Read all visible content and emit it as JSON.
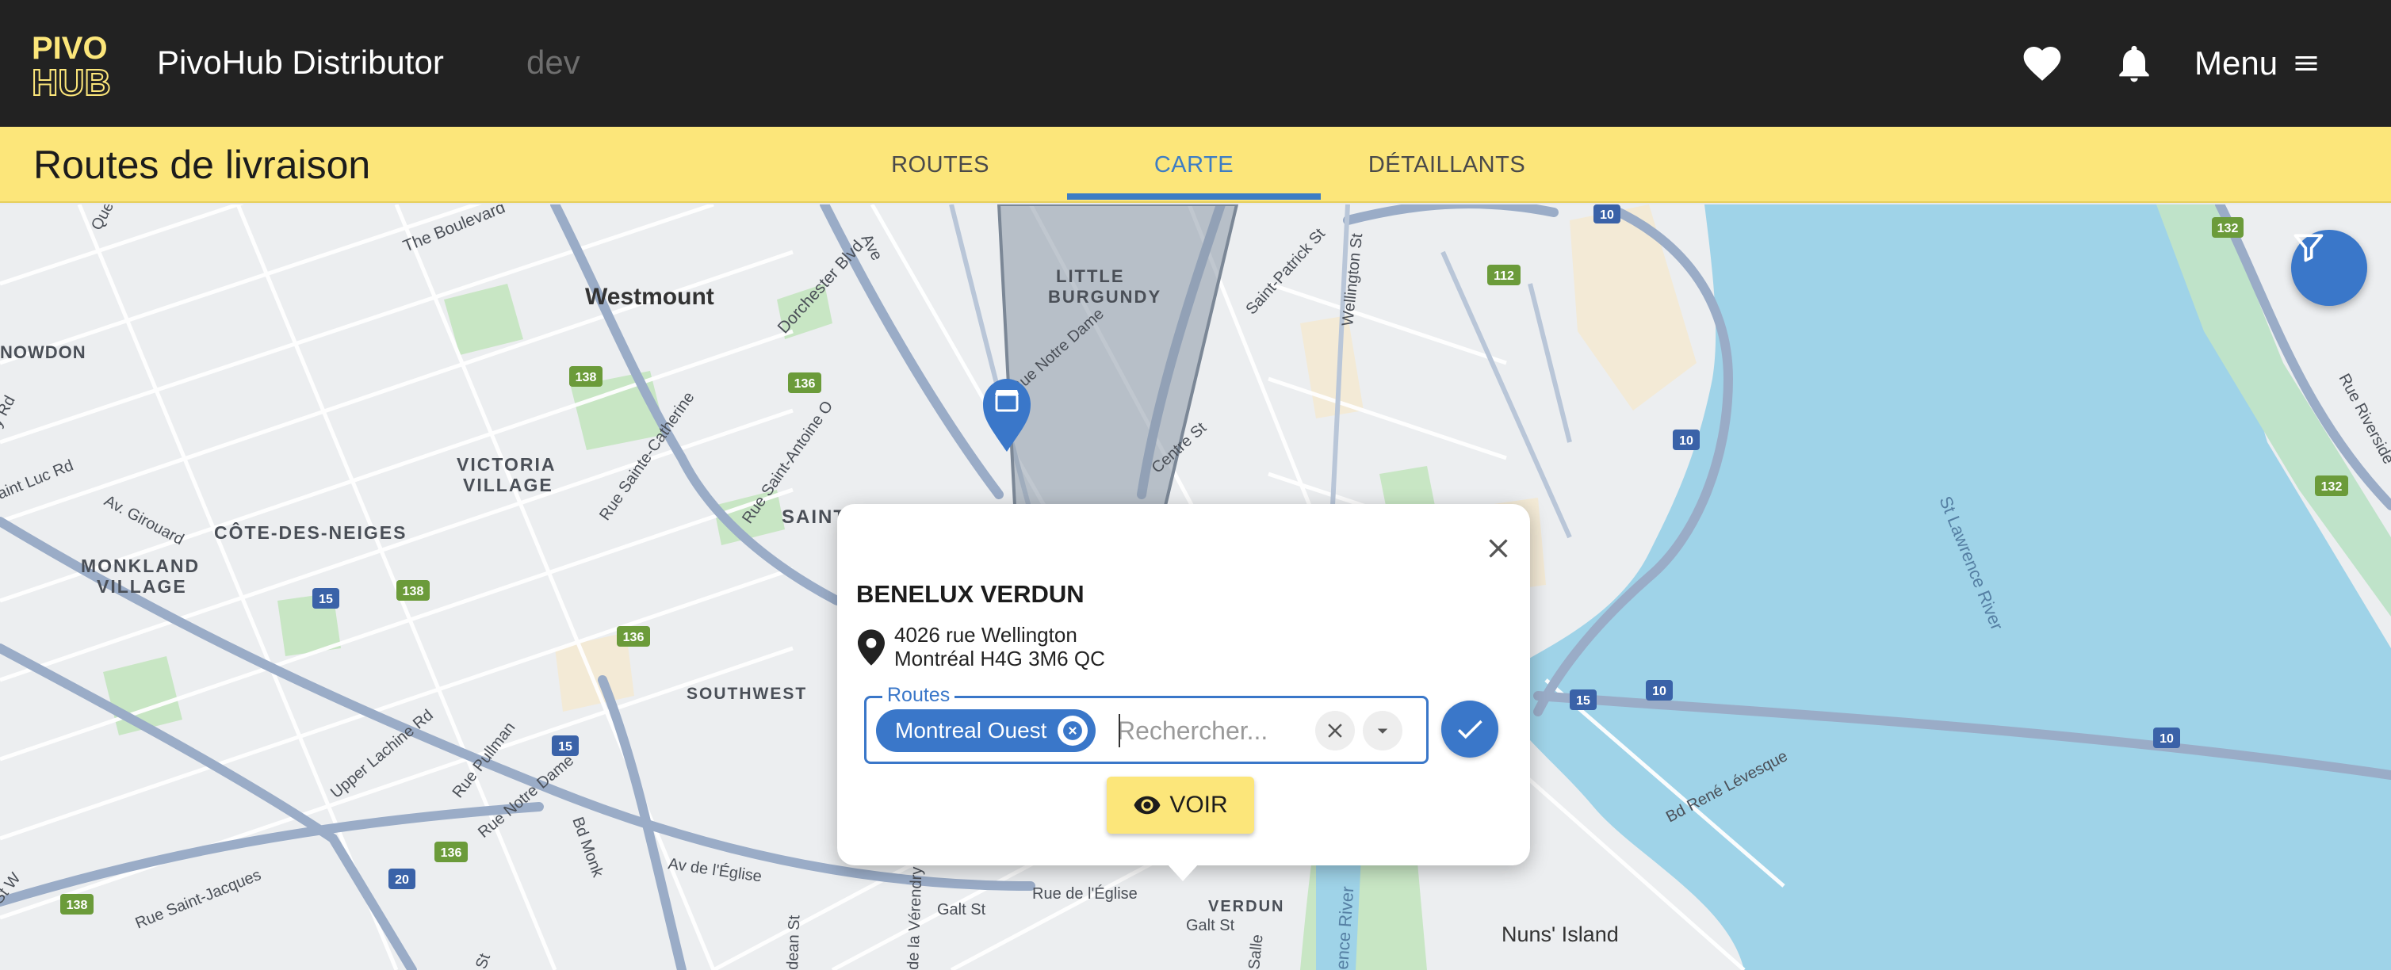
{
  "app": {
    "logo_text_top": "PIVO",
    "logo_text_bottom": "HUB",
    "title": "PivoHub Distributor",
    "env": "dev",
    "menu_label": "Menu",
    "icons": [
      "heart-icon",
      "bell-icon",
      "hamburger-icon"
    ]
  },
  "subbar": {
    "page_title": "Routes de livraison",
    "tabs": [
      {
        "label": "ROUTES",
        "active": false
      },
      {
        "label": "CARTE",
        "active": true
      },
      {
        "label": "DÉTAILLANTS",
        "active": false
      }
    ]
  },
  "map": {
    "labels": {
      "westmount": "Westmount",
      "little_burgundy_1": "LITTLE",
      "little_burgundy_2": "BURGUNDY",
      "victoria_1": "VICTORIA",
      "victoria_2": "VILLAGE",
      "cote_des_neiges": "CÔTE-DES-NEIGES",
      "monkland_1": "MONKLAND",
      "monkland_2": "VILLAGE",
      "southwest": "SOUTHWEST",
      "nowdon": "NOWDON",
      "saint": "SAINT",
      "verdun": "VERDUN",
      "nuns_island": "Nuns' Island",
      "st_lawrence": "St Lawrence River",
      "the_boulevard": "The Boulevard",
      "dorchester": "Dorchester Blvd",
      "rue_notre_dame": "Rue Notre Dame",
      "saint_patrick": "Saint-Patrick St",
      "wellington": "Wellington St",
      "centre": "Centre St",
      "rue_ste_catherine": "Rue Sainte-Catherine",
      "rue_st_antoine": "Rue Saint-Antoine O",
      "av_girouard": "Av. Girouard",
      "saint_luc": "aint Luc Rd",
      "upper_lachine": "Upper Lachine Rd",
      "rue_pullman": "Rue Pullman",
      "rue_notre_dame_2": "Rue Notre Dame",
      "bd_monk": "Bd Monk",
      "av_eglise": "Av de l'Église",
      "rue_eglise": "Rue de l'Église",
      "gault_1": "Galt St",
      "gault_2": "Galt St",
      "rue_st_jacques": "Rue Saint-Jacques",
      "bd_rene_levesque": "Bd René Lévesque",
      "rue_riverside": "Rue Riverside",
      "ave_partial": "Ave",
      "que_partial": "Que",
      "y_rd": "y Rd",
      "st_w": "St W",
      "nence_river": "ence River",
      "dean_st": "dean St",
      "la_verendry": "de la Vérendry",
      "st_partial": "St",
      "sa_partial": "Salle"
    },
    "shields": [
      "10",
      "112",
      "132",
      "138",
      "136",
      "15",
      "20",
      "10",
      "132",
      "15",
      "10",
      "10"
    ]
  },
  "popup": {
    "store_name": "BENELUX VERDUN",
    "address_line1": "4026 rue Wellington",
    "address_line2": "Montréal H4G 3M6 QC",
    "routes_label": "Routes",
    "selected_route": "Montreal Ouest",
    "search_placeholder": "Rechercher...",
    "voir_label": "VOIR"
  },
  "colors": {
    "appbar": "#222222",
    "accent_yellow": "#fce67a",
    "accent_blue": "#3a77c9",
    "water": "#9fd3e8",
    "land": "#e8eaed"
  }
}
